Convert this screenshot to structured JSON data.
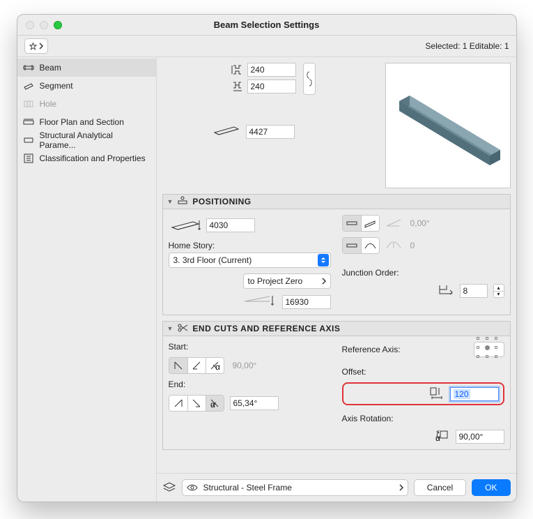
{
  "window_title": "Beam Selection Settings",
  "status": "Selected: 1 Editable: 1",
  "sidebar": [
    {
      "label": "Beam",
      "selected": true
    },
    {
      "label": "Segment"
    },
    {
      "label": "Hole",
      "disabled": true
    },
    {
      "label": "Floor Plan and Section"
    },
    {
      "label": "Structural Analytical Parame..."
    },
    {
      "label": "Classification and Properties"
    }
  ],
  "dims": {
    "height": "240",
    "width": "240",
    "length": "4427"
  },
  "positioning": {
    "header": "POSITIONING",
    "elev": "4030",
    "home_story_label": "Home Story:",
    "home_story": "3. 3rd Floor (Current)",
    "to_ref": "to Project Zero",
    "to_ref_value": "16930",
    "slant_angle": "0,00°",
    "curve": "0",
    "junction_label": "Junction Order:",
    "junction_value": "8"
  },
  "endcuts": {
    "header": "END CUTS AND REFERENCE AXIS",
    "start_label": "Start:",
    "start_angle": "90,00°",
    "end_label": "End:",
    "end_angle": "65,34°",
    "ref_axis_label": "Reference Axis:",
    "offset_label": "Offset:",
    "offset_value": "120",
    "rotation_label": "Axis Rotation:",
    "rotation_value": "90,00°"
  },
  "footer": {
    "layer": "Structural - Steel Frame",
    "cancel": "Cancel",
    "ok": "OK"
  }
}
